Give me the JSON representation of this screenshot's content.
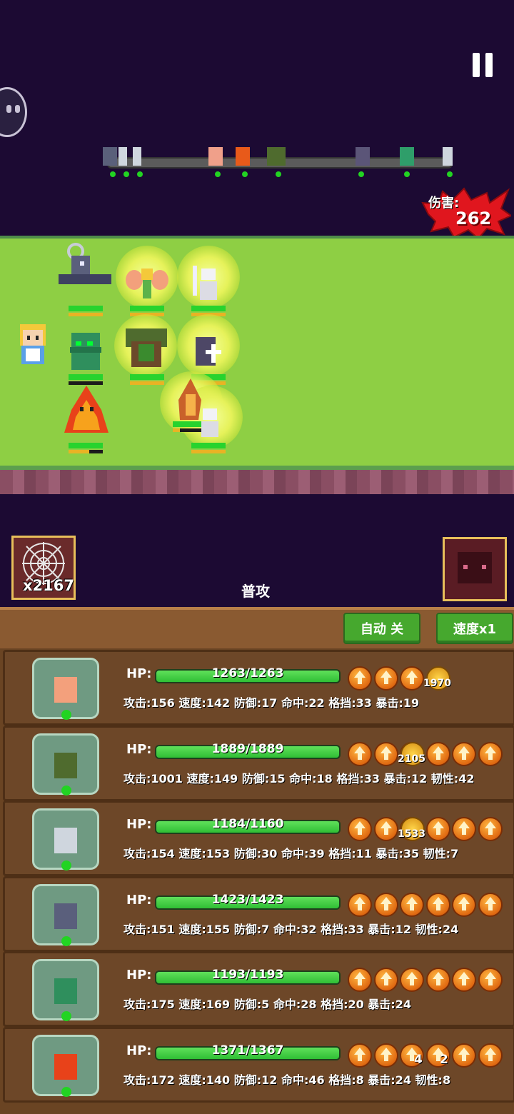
{
  "hud": {
    "damage_label": "伤害:",
    "damage_value": "262"
  },
  "battle": {
    "skill_count": "x2167",
    "action_label": "普攻"
  },
  "controls": {
    "auto_label": "自动 关",
    "speed_label": "速度x1"
  },
  "team": [
    {
      "unit": "fairy",
      "hp_label": "HP:",
      "hp_text": "1263/1263",
      "hp_ratio": 1.0,
      "stats": "攻击:156 速度:142 防御:17 命中:22 格挡:33 暴击:19",
      "badge": "1970"
    },
    {
      "unit": "treant",
      "hp_label": "HP:",
      "hp_text": "1889/1889",
      "hp_ratio": 1.0,
      "stats": "攻击:1001 速度:149 防御:15 命中:18 格挡:33 暴击:12 韧性:42",
      "badge": "2105"
    },
    {
      "unit": "ghost",
      "hp_label": "HP:",
      "hp_text": "1184/1160",
      "hp_ratio": 1.0,
      "stats": "攻击:154 速度:153 防御:30 命中:39 格挡:11 暴击:35 韧性:7",
      "badge": "1533"
    },
    {
      "unit": "reaper",
      "hp_label": "HP:",
      "hp_text": "1423/1423",
      "hp_ratio": 1.0,
      "stats": "攻击:151 速度:155 防御:7 命中:32 格挡:33 暴击:12 韧性:24",
      "badge": ""
    },
    {
      "unit": "goblin",
      "hp_label": "HP:",
      "hp_text": "1193/1193",
      "hp_ratio": 1.0,
      "stats": "攻击:175 速度:169 防御:5 命中:28 格挡:20 暴击:24",
      "badge": ""
    },
    {
      "unit": "fire-spirit",
      "hp_label": "HP:",
      "hp_text": "1371/1367",
      "hp_ratio": 1.0,
      "stats": "攻击:172 速度:140 防御:12 命中:46 格挡:8 暴击:24 韧性:8",
      "badge": ""
    }
  ],
  "floating_numbers": [
    "4",
    "2"
  ],
  "colors": {
    "background": "#1c0a33",
    "field": "#8ecf44",
    "hp_green": "#27d32e",
    "panel": "#6a4423",
    "button_green": "#46a82e",
    "damage_red": "#e0161e"
  }
}
